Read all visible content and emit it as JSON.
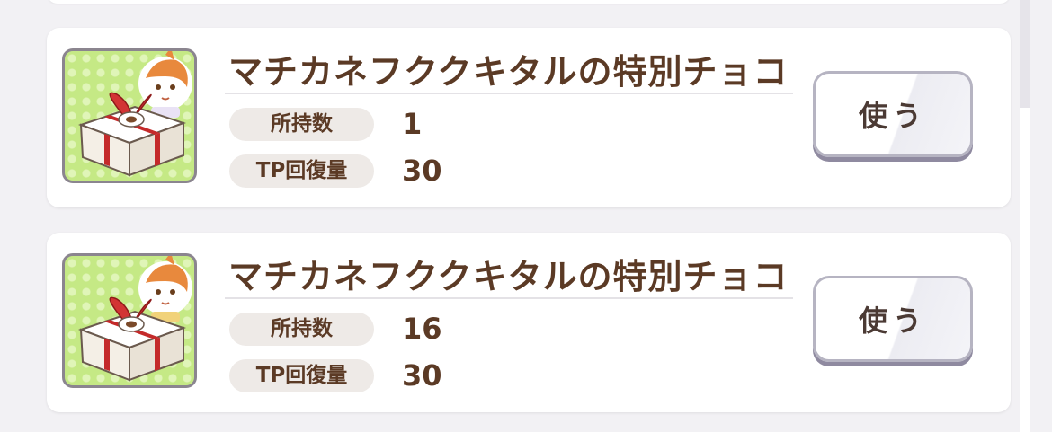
{
  "items": [
    {
      "title": "マチカネフククキタルの特別チョコ",
      "stats": [
        {
          "label": "所持数",
          "value": "1"
        },
        {
          "label": "TP回復量",
          "value": "30"
        }
      ],
      "button_label": "使う"
    },
    {
      "title": "マチカネフククキタルの特別チョコ",
      "stats": [
        {
          "label": "所持数",
          "value": "16"
        },
        {
          "label": "TP回復量",
          "value": "30"
        }
      ],
      "button_label": "使う"
    }
  ],
  "colors": {
    "text_brown": "#5b3a25",
    "card_bg": "#ffffff",
    "page_bg": "#f2f1f4",
    "icon_green": "#c5e985",
    "ribbon_red": "#c42a2a"
  },
  "icons": [
    "gift-box-icon",
    "character-chibi-icon"
  ]
}
